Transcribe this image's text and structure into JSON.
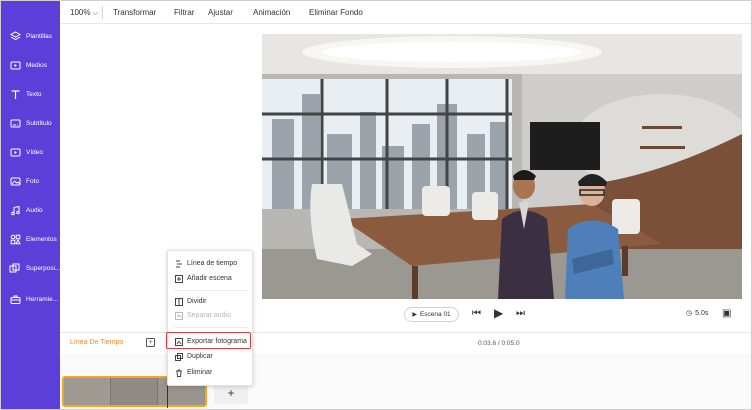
{
  "sidebar": {
    "items": [
      {
        "label": "Plantillas",
        "icon": "layers-icon"
      },
      {
        "label": "Medios",
        "icon": "media-folder-icon"
      },
      {
        "label": "Texto",
        "icon": "text-icon"
      },
      {
        "label": "Subtítulo",
        "icon": "subtitle-icon"
      },
      {
        "label": "Vídeo",
        "icon": "video-icon"
      },
      {
        "label": "Foto",
        "icon": "photo-icon"
      },
      {
        "label": "Audio",
        "icon": "music-icon"
      },
      {
        "label": "Elementos",
        "icon": "elements-icon"
      },
      {
        "label": "Superposi...",
        "icon": "overlay-icon"
      },
      {
        "label": "Herramie...",
        "icon": "toolbox-icon"
      }
    ]
  },
  "toolbar": {
    "zoom": "100%",
    "items": [
      "Transformar",
      "Filtrar",
      "Ajustar",
      "Animación",
      "Eliminar Fondo"
    ]
  },
  "player": {
    "scene": "Escena 01",
    "duration": "5.0s"
  },
  "timeline": {
    "label": "Línea De Tiempo",
    "time": "0:03.6 / 0:05.0"
  },
  "context_menu": {
    "items": [
      {
        "label": "Línea de tiempo",
        "icon": "timeline-icon",
        "enabled": true
      },
      {
        "label": "Añadir escena",
        "icon": "add-scene-icon",
        "enabled": true
      },
      {
        "label": "Dividir",
        "icon": "split-icon",
        "enabled": true
      },
      {
        "label": "Separar audio",
        "icon": "detach-audio-icon",
        "enabled": false
      },
      {
        "label": "Exportar fotograma",
        "icon": "export-frame-icon",
        "enabled": true
      },
      {
        "label": "Duplicar",
        "icon": "duplicate-icon",
        "enabled": true
      },
      {
        "label": "Eliminar",
        "icon": "trash-icon",
        "enabled": true
      }
    ]
  },
  "colors": {
    "sidebar": "#5b3fd9",
    "accent": "#f08a24",
    "highlight_border": "#e03a3a"
  }
}
